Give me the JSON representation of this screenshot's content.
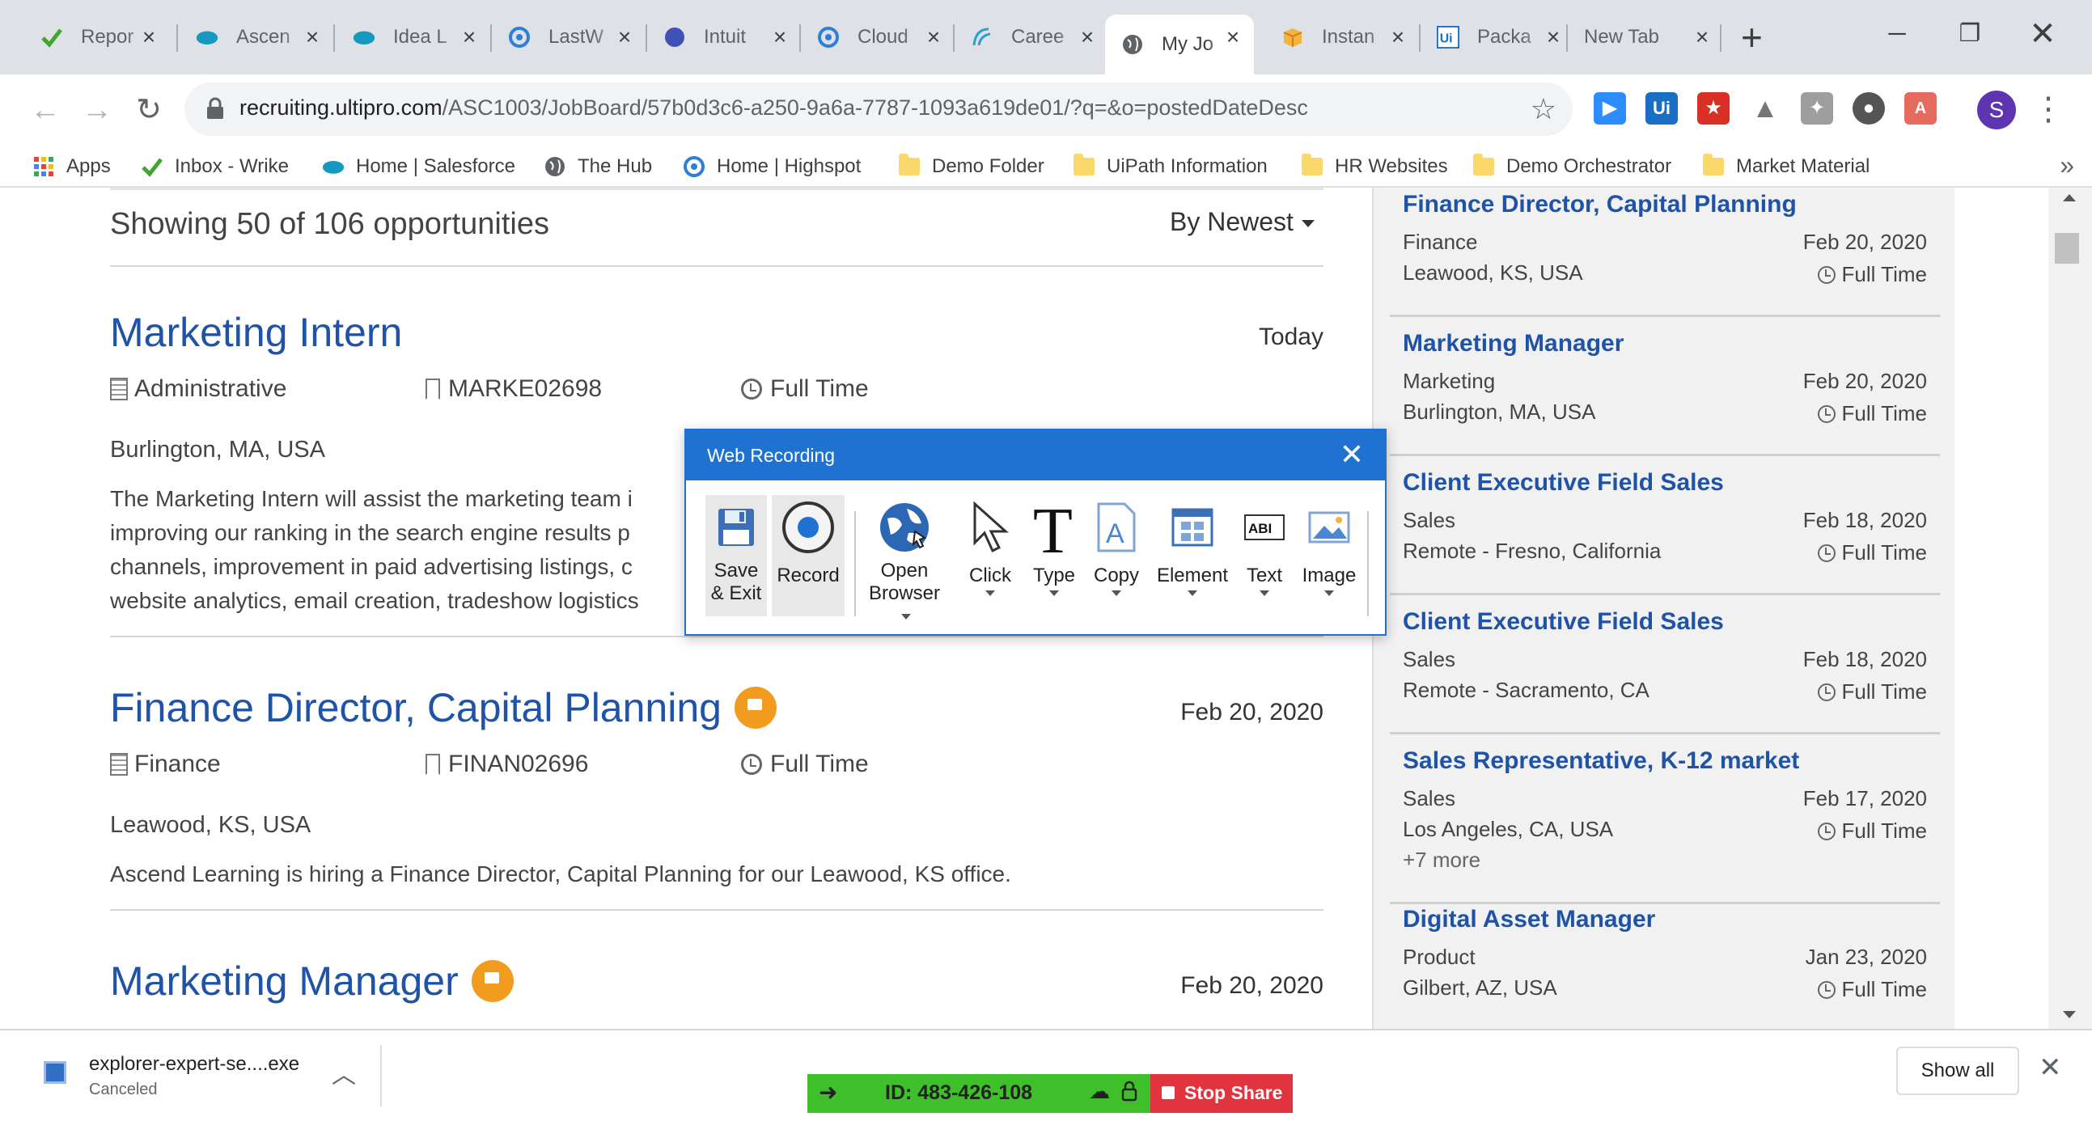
{
  "browser": {
    "tabs": [
      {
        "label": "Repor",
        "icon": "checkmark-icon"
      },
      {
        "label": "Ascen",
        "icon": "salesforce-cloud-icon"
      },
      {
        "label": "Idea L",
        "icon": "salesforce-cloud-icon"
      },
      {
        "label": "LastW",
        "icon": "highspot-icon"
      },
      {
        "label": "Intuit",
        "icon": "blue-dot-icon"
      },
      {
        "label": "Cloud",
        "icon": "highspot-icon"
      },
      {
        "label": "Caree",
        "icon": "ascend-icon"
      },
      {
        "label": "My Jo",
        "icon": "globe-icon"
      },
      {
        "label": "Instan",
        "icon": "box-icon"
      },
      {
        "label": "Packa",
        "icon": "uipath-icon"
      },
      {
        "label": "New Tab",
        "icon": ""
      }
    ],
    "new_tab_symbol": "+",
    "url_host": "recruiting.ultipro.com",
    "url_path": "/ASC1003/JobBoard/57b0d3c6-a250-9a6a-7787-1093a619de01/?q=&o=postedDateDesc",
    "profile_initial": "S",
    "bookmarks": [
      {
        "label": "Apps",
        "icon": "apps-grid-icon"
      },
      {
        "label": "Inbox - Wrike",
        "icon": "checkmark-icon"
      },
      {
        "label": "Home | Salesforce",
        "icon": "salesforce-cloud-icon"
      },
      {
        "label": "The Hub",
        "icon": "globe-icon"
      },
      {
        "label": "Home | Highspot",
        "icon": "highspot-icon"
      },
      {
        "label": "Demo Folder",
        "icon": "folder-icon"
      },
      {
        "label": "UiPath Information",
        "icon": "folder-icon"
      },
      {
        "label": "HR Websites",
        "icon": "folder-icon"
      },
      {
        "label": "Demo Orchestrator",
        "icon": "folder-icon"
      },
      {
        "label": "Market Material",
        "icon": "folder-icon"
      }
    ],
    "bookmarks_overflow": "»"
  },
  "listing": {
    "showing": "Showing 50 of 106 opportunities",
    "sort_label": "By Newest",
    "jobs": [
      {
        "title": "Marketing Intern",
        "date": "Today",
        "dept": "Administrative",
        "req": "MARKE02698",
        "type": "Full Time",
        "location": "Burlington, MA, USA",
        "desc1": "The Marketing Intern will assist the marketing team i",
        "desc2": "improving our ranking in the search engine results p",
        "desc3": "channels, improvement in paid advertising listings, c",
        "desc4": "website analytics, email creation, tradeshow logistics"
      },
      {
        "title": "Finance Director, Capital Planning",
        "date": "Feb 20, 2020",
        "dept": "Finance",
        "req": "FINAN02696",
        "type": "Full Time",
        "location": "Leawood, KS, USA",
        "desc1": "Ascend Learning is hiring a Finance Director, Capital Planning for our Leawood, KS office."
      },
      {
        "title": "Marketing Manager",
        "date": "Feb 20, 2020"
      }
    ]
  },
  "sidebar": {
    "cards": [
      {
        "title": "Finance Director, Capital Planning",
        "dept": "Finance",
        "date": "Feb 20, 2020",
        "location": "Leawood, KS, USA",
        "type": "Full Time"
      },
      {
        "title": "Marketing Manager",
        "dept": "Marketing",
        "date": "Feb 20, 2020",
        "location": "Burlington, MA, USA",
        "type": "Full Time"
      },
      {
        "title": "Client Executive Field Sales",
        "dept": "Sales",
        "date": "Feb 18, 2020",
        "location": "Remote - Fresno, California",
        "type": "Full Time"
      },
      {
        "title": "Client Executive Field Sales",
        "dept": "Sales",
        "date": "Feb 18, 2020",
        "location": "Remote - Sacramento, CA",
        "type": "Full Time"
      },
      {
        "title": "Sales Representative, K-12 market",
        "dept": "Sales",
        "date": "Feb 17, 2020",
        "location": "Los Angeles, CA, USA",
        "type": "Full Time",
        "more": "+7 more"
      },
      {
        "title": "Digital Asset Manager",
        "dept": "Product",
        "date": "Jan 23, 2020",
        "location": "Gilbert, AZ, USA",
        "type": "Full Time"
      }
    ]
  },
  "recorder": {
    "title": "Web Recording",
    "buttons": {
      "save_exit_1": "Save",
      "save_exit_2": "& Exit",
      "record": "Record",
      "open_browser_1": "Open",
      "open_browser_2": "Browser",
      "click": "Click",
      "type": "Type",
      "copy": "Copy",
      "element": "Element",
      "text": "Text",
      "image": "Image"
    },
    "accent": "#1f72d1"
  },
  "downloads": {
    "file": "explorer-expert-se....exe",
    "status": "Canceled",
    "show_all": "Show all"
  },
  "screenshare": {
    "id_label": "ID: 483-426-108",
    "stop": "Stop Share"
  },
  "colors": {
    "link_blue": "#1f53a8",
    "flag_orange": "#f29c1f",
    "share_green": "#3fc02a",
    "share_red": "#e2343f"
  }
}
